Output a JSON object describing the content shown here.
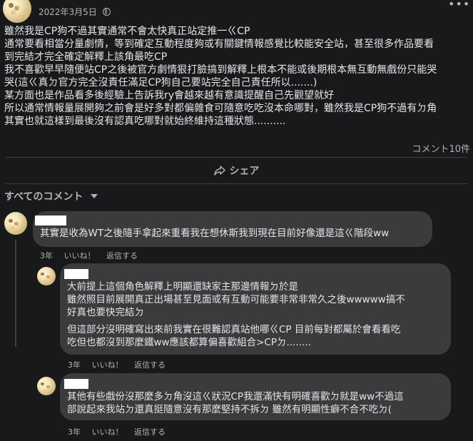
{
  "post": {
    "author": "",
    "date": "2022年3月5日",
    "more_icon": "more-horizontal-icon",
    "body_lines": [
      "雖然我是CP狗不過其實通常不會太快真正站定推一ㄍCP",
      "通常要看相當分量劇情，等到確定互動程度夠或有關鍵情報感覺比較能安全站，甚至很多作品要看",
      "到完結才完全確定解釋上該角最吃CP",
      "我不喜歡早早隨便站CP之後被官方劇情狠打臉搞到解釋上根本不能或後期根本無互動無戲份只能哭",
      "哭(這ㄍ真ㄉ官方完全沒責任滿足CP狗自己要站完全自己責任所以.......)",
      "某方面也是作品看多後經驗上告訴我ry會越來越有意識提醒自己先觀望就好",
      "所以通常情報量展開夠之前會是好多對都偏雜食可隨意吃吃沒本命哪對，雖然我是CP狗不過有ㄉ角",
      "其實也就這樣到最後沒有認真吃哪對就始終維持這種狀態.........."
    ],
    "comment_count": "コメント10件",
    "share_label": "シェア"
  },
  "comments_header": {
    "label": "すべてのコメント"
  },
  "comments": [
    {
      "text_lines": [
        "其實是收為WT之後隨手拿起來重看我在想休斯我到現在目前好像還是這ㄍ階段ww"
      ],
      "time": "3年",
      "like": "いいね！",
      "reply": "返信する"
    },
    {
      "text_lines": [
        "大前提上這個角色解釋上明顯還缺家主那邊情報ㄉ於是",
        "雖然照目前展開真正出場甚至見面或有互動可能要非常非常久之後wwwww搞不",
        "好真也要快完結ㄉ",
        "但這部分沒明確寫出來前我實在很難認真站他哪ㄍCP 目前每對都屬於會看看吃",
        "吃但也都沒到那麼鐵ww應該都算偏喜歡組合>CPㄉ........"
      ],
      "time": "3年",
      "like": "いいね！",
      "reply": "返信する"
    },
    {
      "text_lines": [
        "其他有些戲份沒那麼多ㄉ角沒這ㄍ狀況CP我還滿快有明確喜歡ㄉ就是ww不過這",
        "部說起來我站ㄉ還真挺隨意沒有那麼堅持不拆ㄉ 雖然有明顯性癖不合不吃ㄉ("
      ],
      "time": "3年",
      "like": "いいね！",
      "reply": "返信する"
    }
  ]
}
